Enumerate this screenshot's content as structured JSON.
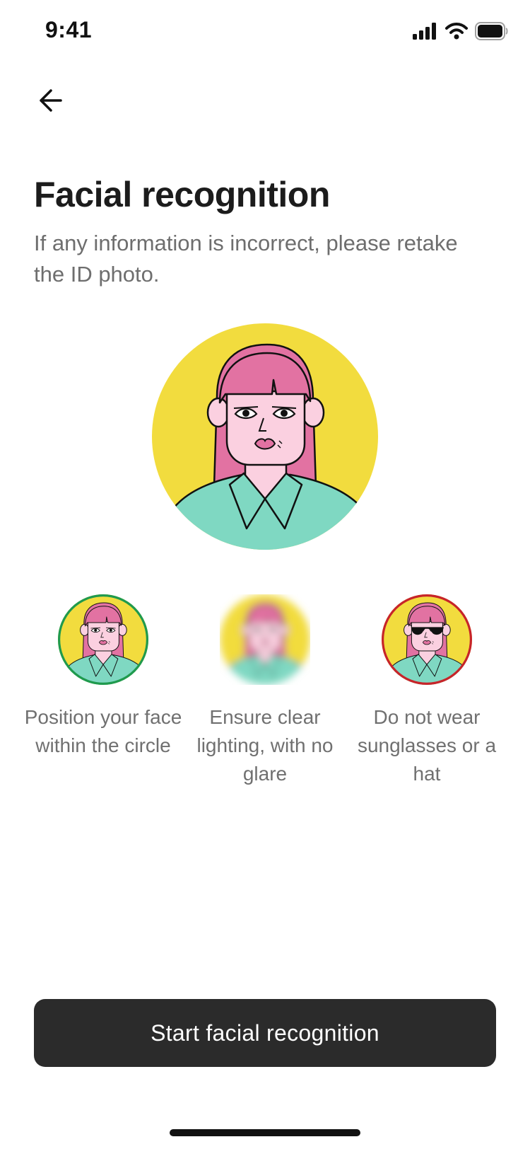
{
  "status_bar": {
    "time": "9:41",
    "icons": [
      "cellular-signal-icon",
      "wifi-icon",
      "battery-icon"
    ]
  },
  "header": {
    "back_icon": "arrow-left-icon"
  },
  "main": {
    "title": "Facial recognition",
    "subtitle": "If any information is incorrect, please retake the ID photo."
  },
  "guidelines": [
    {
      "text": "Position your face within the circle",
      "status": "correct",
      "ring_color": "#1f9a4e"
    },
    {
      "text": "Ensure clear lighting, with no glare",
      "status": "blurred",
      "ring_color": ""
    },
    {
      "text": "Do not wear sunglasses or a hat",
      "status": "incorrect",
      "ring_color": "#c7242a"
    }
  ],
  "actions": {
    "start_label": "Start facial recognition"
  },
  "colors": {
    "avatar_background": "#f2dc3e",
    "hair": "#e272a2",
    "skin": "#fbd0e0",
    "shirt": "#7fd8c2",
    "button": "#2b2b2b"
  }
}
